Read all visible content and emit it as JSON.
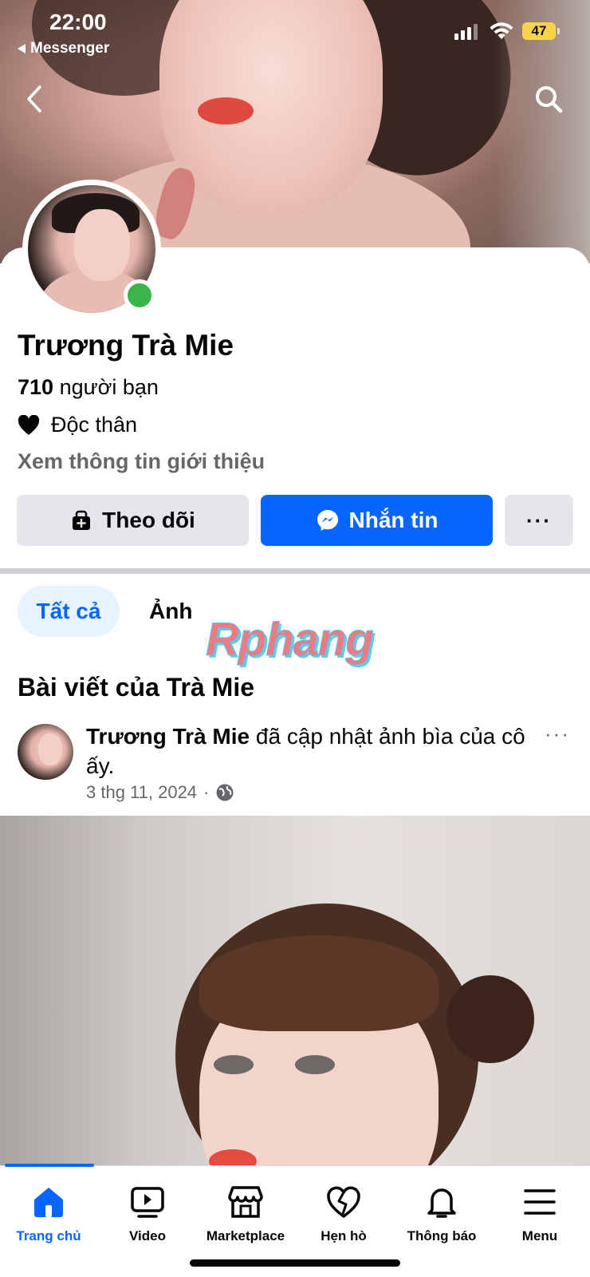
{
  "status_bar": {
    "time": "22:00",
    "back_app": "Messenger",
    "battery": "47"
  },
  "profile": {
    "name": "Trương Trà Mie",
    "friends_count": "710",
    "friends_label": "người bạn",
    "relationship": "Độc thân",
    "intro_link": "Xem thông tin giới thiệu"
  },
  "actions": {
    "follow": "Theo dõi",
    "message": "Nhắn tin",
    "more": "···"
  },
  "tabs": {
    "all": "Tất cả",
    "photos": "Ảnh"
  },
  "watermark": "Rphang",
  "posts": {
    "title": "Bài viết của Trà Mie",
    "items": [
      {
        "author": "Trương Trà Mie",
        "action": "đã cập nhật ảnh bìa của cô ấy.",
        "date": "3 thg 11, 2024",
        "more": "···"
      }
    ]
  },
  "bottom_nav": [
    {
      "label": "Trang chủ",
      "icon": "home-icon",
      "active": true
    },
    {
      "label": "Video",
      "icon": "video-icon"
    },
    {
      "label": "Marketplace",
      "icon": "marketplace-icon"
    },
    {
      "label": "Hẹn hò",
      "icon": "dating-icon"
    },
    {
      "label": "Thông báo",
      "icon": "bell-icon"
    },
    {
      "label": "Menu",
      "icon": "menu-icon"
    }
  ],
  "colors": {
    "accent": "#0866ff",
    "online": "#3ab54a",
    "muted": "#65676b"
  }
}
